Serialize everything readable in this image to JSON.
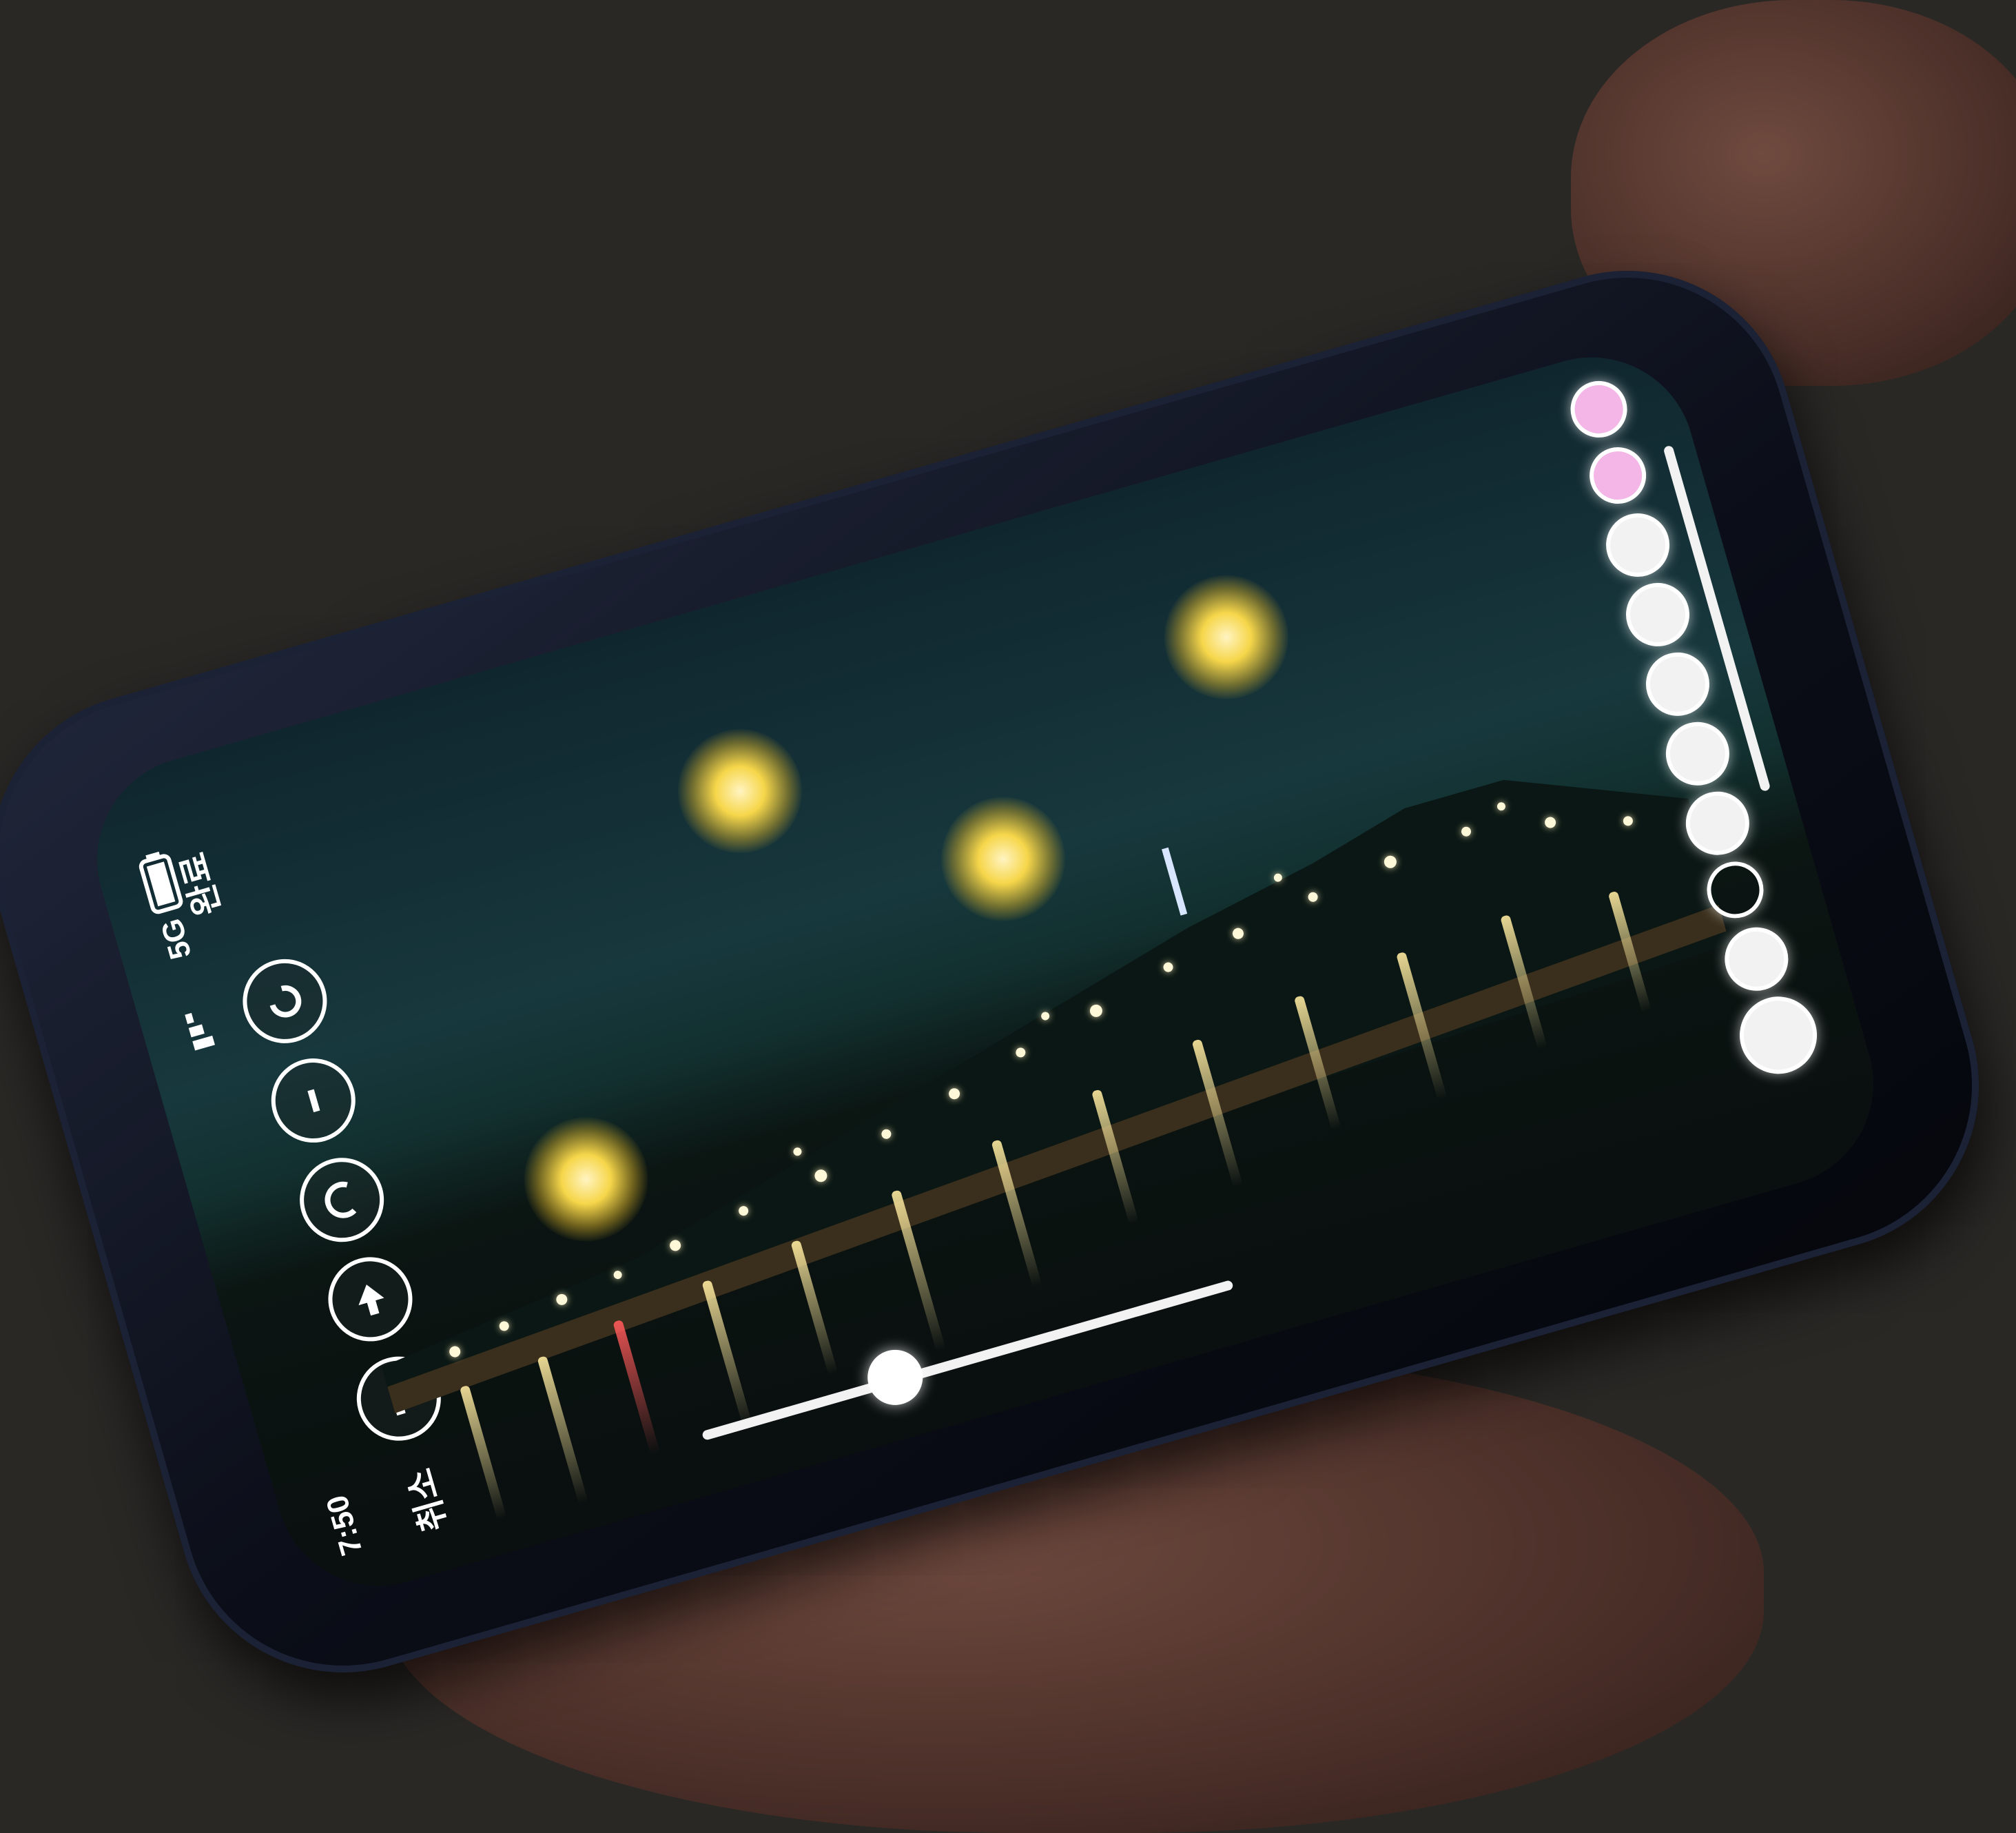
{
  "status_bar": {
    "time": "7:50",
    "carrier": "5G",
    "battery_icon": "battery-icon",
    "signal_icon": "signal-icon"
  },
  "editor": {
    "cancel_label": "취소",
    "done_label": "완료"
  },
  "left_tools": [
    {
      "name": "undo-button",
      "icon": "undo-icon"
    },
    {
      "name": "info-button",
      "icon": "info-icon"
    },
    {
      "name": "back-button",
      "icon": "back-icon"
    },
    {
      "name": "share-button",
      "icon": "share-icon"
    },
    {
      "name": "redo-button",
      "icon": "redo-icon"
    }
  ],
  "colors": {
    "swatch_pink": "#f3b6e6",
    "swatch_white": "#f2f2f2",
    "orb_glow": "#f6d64a",
    "sky": "#17383d"
  },
  "brush_size": {
    "value": 0.35
  }
}
